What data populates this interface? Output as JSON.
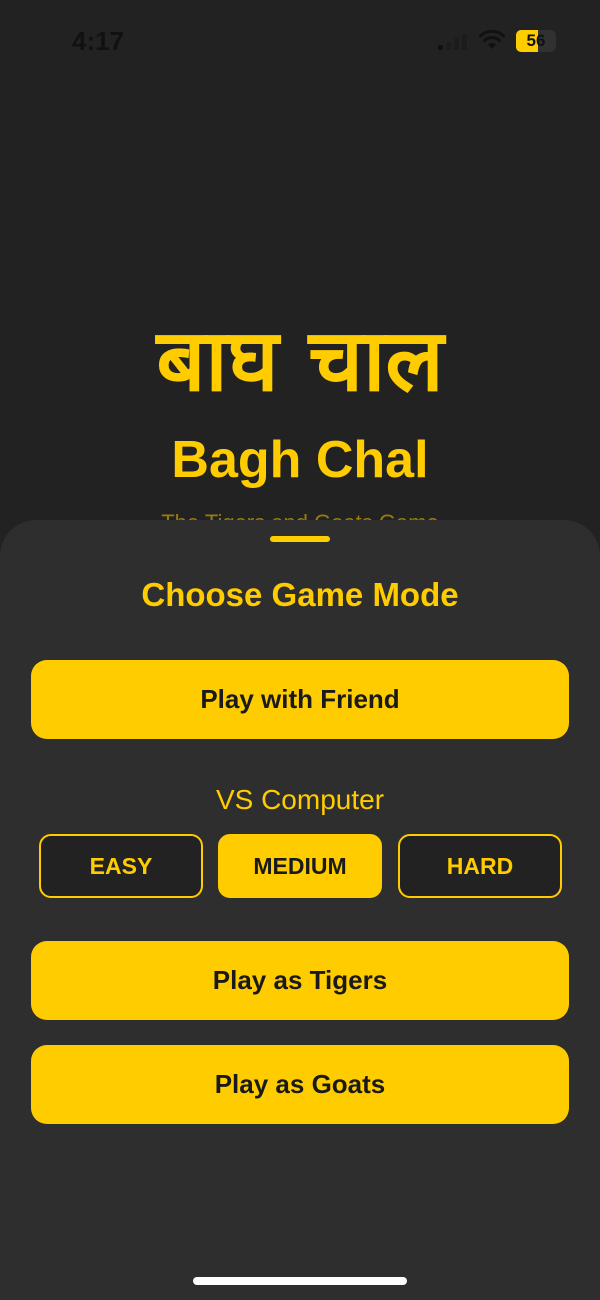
{
  "status_bar": {
    "time": "4:17",
    "battery": "56",
    "icons": [
      "signal-icon",
      "wifi-icon",
      "battery-icon"
    ]
  },
  "header": {
    "title_hindi": "बाघ चाल",
    "title_english": "Bagh Chal",
    "tagline": "The Tigers and Goats Game"
  },
  "sheet": {
    "title": "Choose Game Mode",
    "play_friend_label": "Play with Friend",
    "vs_computer_label": "VS Computer",
    "difficulty": {
      "options": [
        "EASY",
        "MEDIUM",
        "HARD"
      ],
      "selected": "MEDIUM"
    },
    "play_tigers_label": "Play as Tigers",
    "play_goats_label": "Play as Goats"
  },
  "colors": {
    "accent": "#FFCC00",
    "background": "#222222",
    "sheet": "#2E2E2E",
    "button_text": "#1A1A1A"
  }
}
